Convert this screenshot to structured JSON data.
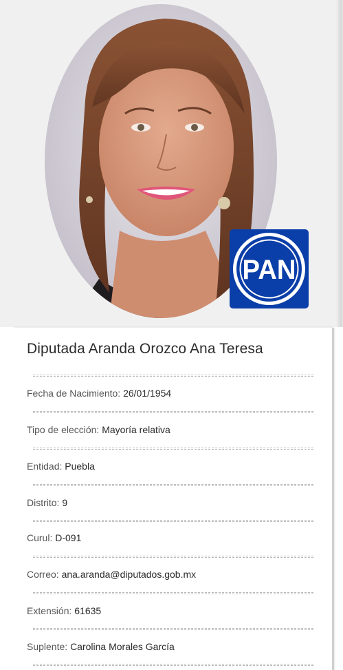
{
  "title": "Diputada Aranda Orozco Ana Teresa",
  "party_logo": {
    "text": "PAN",
    "background": "#0a3ea8",
    "foreground": "#ffffff"
  },
  "fields": [
    {
      "label": "Fecha de Nacimiento:",
      "value": "26/01/1954"
    },
    {
      "label": "Tipo de elección:",
      "value": "Mayoría relativa"
    },
    {
      "label": "Entidad:",
      "value": "Puebla"
    },
    {
      "label": "Distrito:",
      "value": "9"
    },
    {
      "label": "Curul:",
      "value": "D-091"
    },
    {
      "label": "Correo:",
      "value": "ana.aranda@diputados.gob.mx"
    },
    {
      "label": "Extensión:",
      "value": "61635"
    },
    {
      "label": "Suplente:",
      "value": "Carolina Morales García"
    }
  ],
  "colors": {
    "photo_background": "#f0f0f0",
    "text": "#2c2c2c",
    "label": "#555555"
  }
}
